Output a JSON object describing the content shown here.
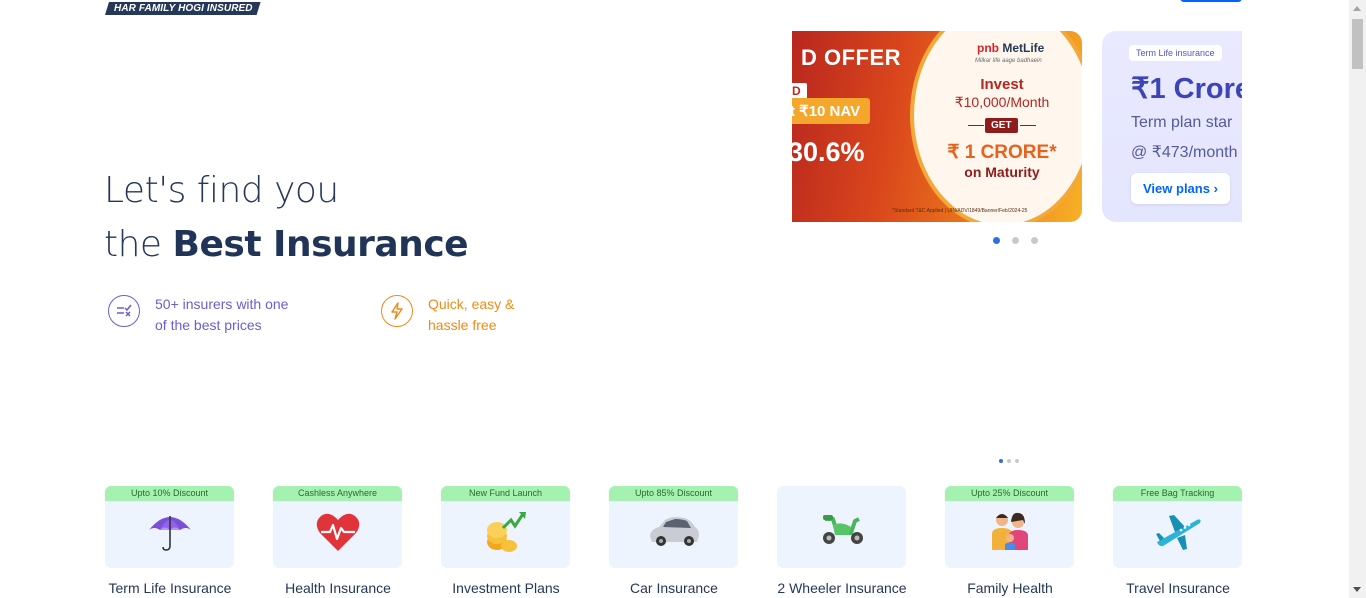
{
  "header": {
    "tagline": "HAR FAMILY HOGI INSURED"
  },
  "hero": {
    "line1": "Let's find you",
    "line2_prefix": "the ",
    "line2_bold": "Best Insurance",
    "features": [
      {
        "line1": "50+ insurers with one",
        "line2": "of the best prices",
        "icon": "compare-icon",
        "color": "#6b5dd3"
      },
      {
        "line1": "Quick, easy &",
        "line2": "hassle free",
        "icon": "lightning-icon",
        "color": "#ef8a17"
      }
    ]
  },
  "banners": {
    "banner1": {
      "offer": "D OFFER",
      "tag_d": "D",
      "nav": "t ₹10 NAV",
      "percent": "30.6%",
      "brand_prefix": "pnb",
      "brand_name": "MetLife",
      "slogan": "Milkar life aage badhaein",
      "invest": "Invest",
      "amount": "₹10,000/Month",
      "get": "GET",
      "crore": "₹ 1 CRORE*",
      "maturity": "on Maturity",
      "disclaimer": "*Standard T&C Applied | UIN/ADV/1849/Banner/Feb/2024-25"
    },
    "banner2": {
      "tag": "Term Life insurance",
      "amount": "₹1 Crore",
      "subtitle": "Term plan star",
      "price": "@ ₹473/month",
      "button": "View plans ›"
    }
  },
  "products": [
    {
      "badge": "Upto 10% Discount",
      "name": "Term Life Insurance",
      "icon": "umbrella-icon"
    },
    {
      "badge": "Cashless Anywhere",
      "name": "Health Insurance",
      "icon": "heart-icon"
    },
    {
      "badge": "New Fund Launch",
      "name": "Investment Plans",
      "icon": "coins-growth-icon"
    },
    {
      "badge": "Upto 85% Discount",
      "name": "Car Insurance",
      "icon": "car-icon"
    },
    {
      "badge": "",
      "name": "2 Wheeler Insurance",
      "icon": "scooter-icon"
    },
    {
      "badge": "Upto 25% Discount",
      "name": "Family Health",
      "icon": "family-icon"
    },
    {
      "badge": "Free Bag Tracking",
      "name": "Travel Insurance",
      "icon": "airplane-icon"
    }
  ],
  "colors": {
    "primary_text": "#253858",
    "accent_blue": "#0065ff",
    "badge_green": "#a5f2b0",
    "card_bg": "#eef4fd"
  }
}
